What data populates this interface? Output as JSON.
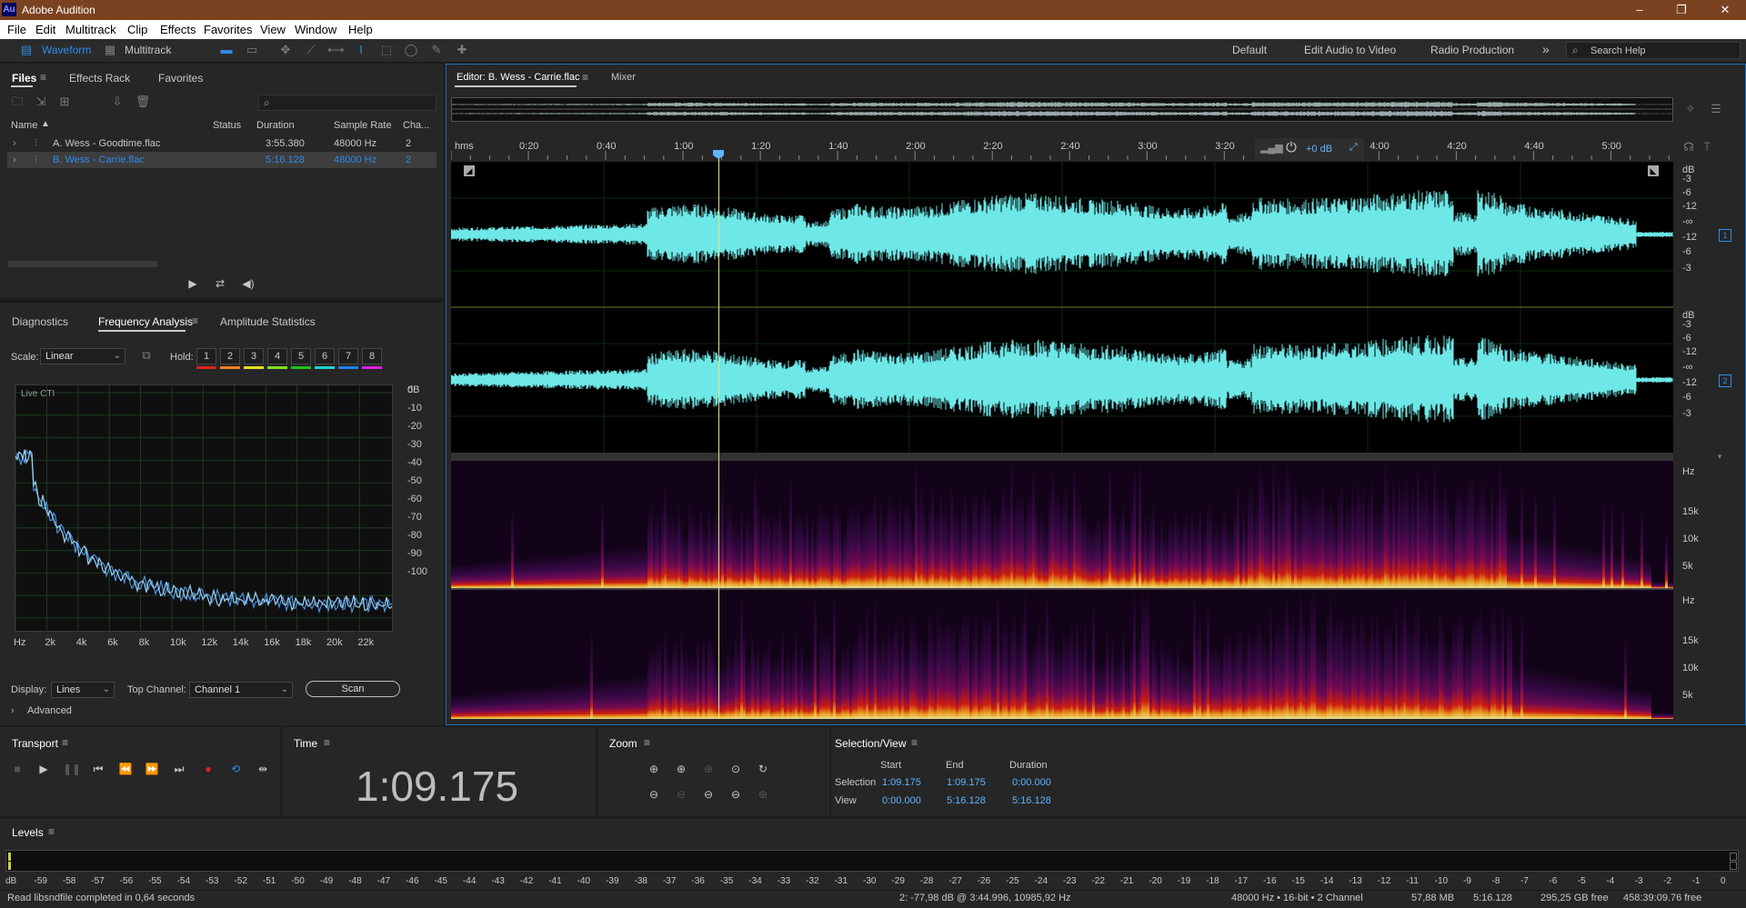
{
  "window": {
    "title": "Adobe Audition",
    "logo_text": "Au",
    "minimize": "–",
    "restore": "❐",
    "close": "✕"
  },
  "menu": [
    "File",
    "Edit",
    "Multitrack",
    "Clip",
    "Effects",
    "Favorites",
    "View",
    "Window",
    "Help"
  ],
  "toolbar": {
    "waveform": "Waveform",
    "multitrack": "Multitrack",
    "workspaces": [
      "Default",
      "Edit Audio to Video",
      "Radio Production"
    ],
    "more": "»",
    "search_placeholder": "Search Help"
  },
  "files_panel": {
    "tabs": [
      "Files",
      "Effects Rack",
      "Favorites"
    ],
    "columns": [
      "Name",
      "Status",
      "Duration",
      "Sample Rate",
      "Cha..."
    ],
    "rows": [
      {
        "name": "A. Wess - Goodtime.flac",
        "status": "",
        "duration": "3:55.380",
        "sample_rate": "48000 Hz",
        "channels": "2",
        "selected": false
      },
      {
        "name": "B. Wess - Carrie.flac",
        "status": "",
        "duration": "5:16.128",
        "sample_rate": "48000 Hz",
        "channels": "2",
        "selected": true
      }
    ]
  },
  "analysis_panel": {
    "tabs": [
      "Diagnostics",
      "Frequency Analysis",
      "Amplitude Statistics"
    ],
    "scale_label": "Scale:",
    "scale_value": "Linear",
    "hold_label": "Hold:",
    "hold_buttons": [
      {
        "label": "1",
        "color": "#e02020"
      },
      {
        "label": "2",
        "color": "#f08020"
      },
      {
        "label": "3",
        "color": "#e8e020"
      },
      {
        "label": "4",
        "color": "#80e020"
      },
      {
        "label": "5",
        "color": "#20c020"
      },
      {
        "label": "6",
        "color": "#20d0d0"
      },
      {
        "label": "7",
        "color": "#2080f0"
      },
      {
        "label": "8",
        "color": "#e020e0"
      }
    ],
    "graph_label": "Live CTI",
    "db_unit": "dB",
    "db_ticks": [
      "0",
      "-10",
      "-20",
      "-30",
      "-40",
      "-50",
      "-60",
      "-70",
      "-80",
      "-90",
      "-100"
    ],
    "hz_ticks": [
      "Hz",
      "2k",
      "4k",
      "6k",
      "8k",
      "10k",
      "12k",
      "14k",
      "16k",
      "18k",
      "20k",
      "22k"
    ],
    "display_label": "Display:",
    "display_value": "Lines",
    "top_channel_label": "Top Channel:",
    "top_channel_value": "Channel 1",
    "scan_button": "Scan",
    "advanced": "Advanced"
  },
  "editor": {
    "tab_label": "Editor: B. Wess - Carrie.flac",
    "mixer_tab": "Mixer",
    "time_ticks": [
      "hms",
      "0:20",
      "0:40",
      "1:00",
      "1:20",
      "1:40",
      "2:00",
      "2:20",
      "2:40",
      "3:00",
      "3:20",
      "4:00",
      "4:20",
      "4:40",
      "5:00"
    ],
    "gain": "+0 dB",
    "db_ticks": [
      "dB",
      "-3",
      "-6",
      "-12",
      "-∞",
      "-12",
      "-6",
      "-3"
    ],
    "channel_labels": [
      "1",
      "2"
    ],
    "hz_unit": "Hz",
    "spectral_ticks": [
      "15k",
      "10k",
      "5k"
    ],
    "waveform_color": "#6ee7e7",
    "playhead_color": "#e5e58a",
    "cursor_time_s": 69.175,
    "duration_s": 316.128
  },
  "transport": {
    "title": "Transport"
  },
  "time_panel": {
    "title": "Time",
    "value": "1:09.175"
  },
  "zoom_panel": {
    "title": "Zoom"
  },
  "selection_view": {
    "title": "Selection/View",
    "headers": [
      "Start",
      "End",
      "Duration"
    ],
    "selection_label": "Selection",
    "selection": [
      "1:09.175",
      "1:09.175",
      "0:00.000"
    ],
    "view_label": "View",
    "view": [
      "0:00.000",
      "5:16.128",
      "5:16.128"
    ]
  },
  "levels": {
    "title": "Levels",
    "ticks": [
      "dB",
      "-59",
      "-58",
      "-57",
      "-56",
      "-55",
      "-54",
      "-53",
      "-52",
      "-51",
      "-50",
      "-49",
      "-48",
      "-47",
      "-46",
      "-45",
      "-44",
      "-43",
      "-42",
      "-41",
      "-40",
      "-39",
      "-38",
      "-37",
      "-36",
      "-35",
      "-34",
      "-33",
      "-32",
      "-31",
      "-30",
      "-29",
      "-28",
      "-27",
      "-26",
      "-25",
      "-24",
      "-23",
      "-22",
      "-21",
      "-20",
      "-19",
      "-18",
      "-17",
      "-16",
      "-15",
      "-14",
      "-13",
      "-12",
      "-11",
      "-10",
      "-9",
      "-8",
      "-7",
      "-6",
      "-5",
      "-4",
      "-3",
      "-2",
      "-1",
      "0"
    ]
  },
  "status_bar": {
    "message": "Read libsndfile completed in 0,64 seconds",
    "cursor_info": "2: -77,98 dB @ 3:44.996, 10985,92 Hz",
    "format": "48000 Hz • 16-bit • 2 Channel",
    "size": "57,88 MB",
    "duration": "5:16.128",
    "free_space": "295,25 GB free",
    "free_time": "458:39:09.76 free"
  }
}
